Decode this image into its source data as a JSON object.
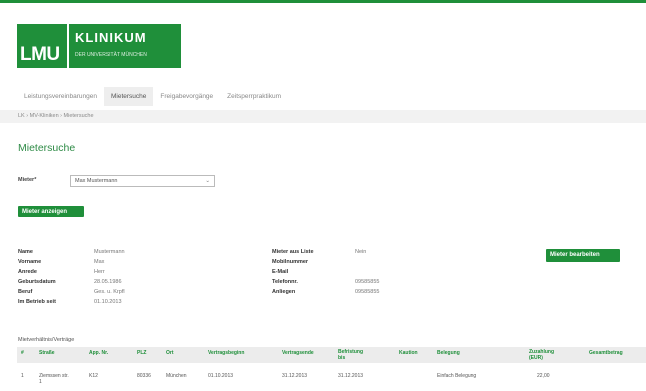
{
  "header": {
    "logo_short": "LMU",
    "logo_name": "KLINIKUM",
    "logo_sub": "DER UNIVERSITÄT MÜNCHEN"
  },
  "nav": {
    "items": [
      {
        "label": "Leistungsvereinbarungen"
      },
      {
        "label": "Mietersuche"
      },
      {
        "label": "Freigabevorgänge"
      },
      {
        "label": "Zeitsperrpraktikum"
      }
    ]
  },
  "breadcrumb": "LK › MV-Kliniken › Mietersuche",
  "page_title": "Mietersuche",
  "filter": {
    "label": "Mieter*",
    "selected": "Max Mustermann"
  },
  "buttons": {
    "load": "Mieter anzeigen",
    "edit": "Mieter bearbeiten"
  },
  "info": {
    "left": [
      {
        "label": "Name",
        "value": "Mustermann"
      },
      {
        "label": "Vorname",
        "value": "Max"
      },
      {
        "label": "Anrede",
        "value": "Herr"
      },
      {
        "label": "Geburtsdatum",
        "value": "28.05.1986"
      },
      {
        "label": "Beruf",
        "value": "Ges. u. Krpfl"
      },
      {
        "label": "Im Betrieb seit",
        "value": "01.10.2013"
      }
    ],
    "right": [
      {
        "label": "Mieter aus Liste",
        "value": "Nein"
      },
      {
        "label": "Mobilnummer",
        "value": ""
      },
      {
        "label": "E-Mail",
        "value": ""
      },
      {
        "label": "Telefonnr.",
        "value": "09585855"
      },
      {
        "label": "Anliegen",
        "value": "09585855"
      }
    ]
  },
  "table": {
    "section_title": "Mietverhältnis/Verträge",
    "columns": [
      "#",
      "Straße",
      "App. Nr.",
      "PLZ",
      "Ort",
      "Vertragsbeginn",
      "Vertragsende",
      "Befristung bis",
      "Kaution",
      "Belegung",
      "Zuzahlung (EUR)",
      "Gesamtbetrag"
    ],
    "rows": [
      [
        "1",
        "Ziemssen str. 1",
        "K12",
        "80336",
        "München",
        "01.10.2013",
        "31.12.2013",
        "31.12.2013",
        "",
        "Einfach Belegung",
        "22,00",
        ""
      ]
    ]
  },
  "colors": {
    "brand": "#1f8f3a"
  }
}
